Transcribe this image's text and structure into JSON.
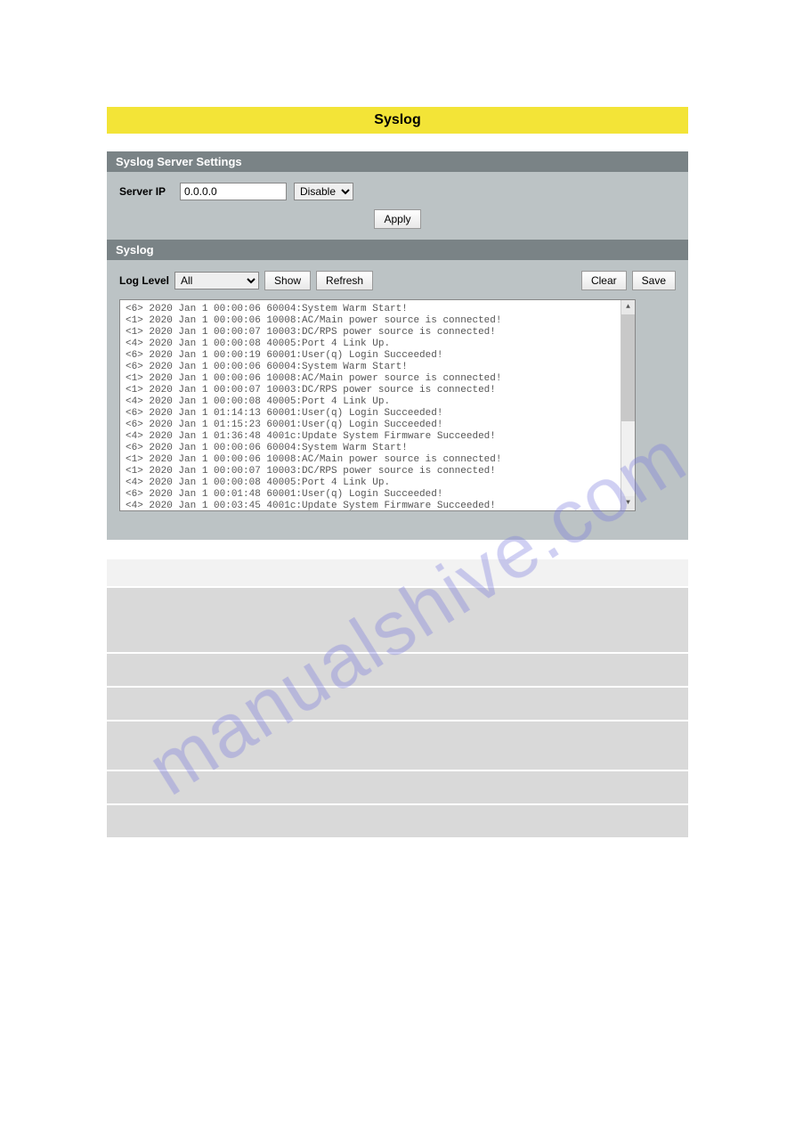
{
  "title": "Syslog",
  "syslog_server_settings": {
    "header": "Syslog Server Settings",
    "server_ip_label": "Server IP",
    "server_ip_value": "0.0.0.0",
    "mode_selected": "Disable",
    "apply_label": "Apply"
  },
  "syslog_section": {
    "header": "Syslog",
    "log_level_label": "Log Level",
    "log_level_selected": "All",
    "show_label": "Show",
    "refresh_label": "Refresh",
    "clear_label": "Clear",
    "save_label": "Save"
  },
  "log_entries": [
    "<6> 2020 Jan 1 00:00:06 60004:System Warm Start!",
    "<1> 2020 Jan 1 00:00:06 10008:AC/Main power source is connected!",
    "<1> 2020 Jan 1 00:00:07 10003:DC/RPS power source is connected!",
    "<4> 2020 Jan 1 00:00:08 40005:Port 4 Link Up.",
    "<6> 2020 Jan 1 00:00:19 60001:User(q) Login Succeeded!",
    "<6> 2020 Jan 1 00:00:06 60004:System Warm Start!",
    "<1> 2020 Jan 1 00:00:06 10008:AC/Main power source is connected!",
    "<1> 2020 Jan 1 00:00:07 10003:DC/RPS power source is connected!",
    "<4> 2020 Jan 1 00:00:08 40005:Port 4 Link Up.",
    "<6> 2020 Jan 1 01:14:13 60001:User(q) Login Succeeded!",
    "<6> 2020 Jan 1 01:15:23 60001:User(q) Login Succeeded!",
    "<4> 2020 Jan 1 01:36:48 4001c:Update System Firmware Succeeded!",
    "<6> 2020 Jan 1 00:00:06 60004:System Warm Start!",
    "<1> 2020 Jan 1 00:00:06 10008:AC/Main power source is connected!",
    "<1> 2020 Jan 1 00:00:07 10003:DC/RPS power source is connected!",
    "<4> 2020 Jan 1 00:00:08 40005:Port 4 Link Up.",
    "<6> 2020 Jan 1 00:01:48 60001:User(q) Login Succeeded!",
    "<4> 2020 Jan 1 00:03:45 4001c:Update System Firmware Succeeded!"
  ],
  "watermark": "manualshive.com"
}
